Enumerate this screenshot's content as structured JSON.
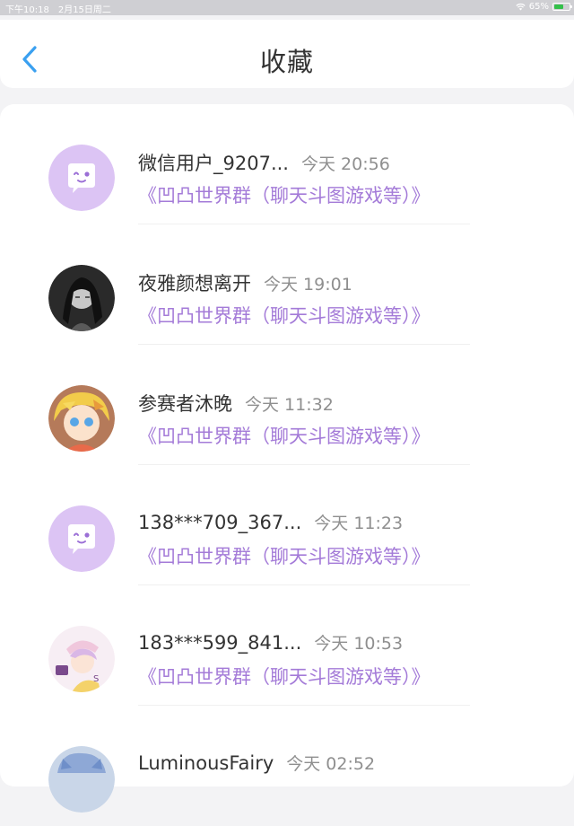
{
  "status": {
    "time": "下午10:18",
    "date": "2月15日周二",
    "battery": "65%",
    "battery_level": 0.65,
    "icons": [
      "wifi-icon",
      "battery-icon"
    ]
  },
  "header": {
    "title": "收藏",
    "back_icon": "chevron-left-icon"
  },
  "colors": {
    "accent": "#3aa0f0",
    "group_text": "#a47bd8",
    "default_avatar_bg": "#dcc4f4"
  },
  "favorites": [
    {
      "name": "微信用户_9207...",
      "time": "今天 20:56",
      "group": "《凹凸世界群（聊天斗图游戏等）》",
      "avatar": "default-avatar-icon"
    },
    {
      "name": "夜雅颜想离开",
      "time": "今天 19:01",
      "group": "《凹凸世界群（聊天斗图游戏等）》",
      "avatar": "user-avatar-dark"
    },
    {
      "name": "参赛者沐晚",
      "time": "今天 11:32",
      "group": "《凹凸世界群（聊天斗图游戏等）》",
      "avatar": "user-avatar-yellow"
    },
    {
      "name": "138***709_367...",
      "time": "今天 11:23",
      "group": "《凹凸世界群（聊天斗图游戏等）》",
      "avatar": "default-avatar-icon"
    },
    {
      "name": "183***599_841...",
      "time": "今天 10:53",
      "group": "《凹凸世界群（聊天斗图游戏等）》",
      "avatar": "user-avatar-pink"
    },
    {
      "name": "LuminousFairy",
      "time": "今天 02:52",
      "group": "",
      "avatar": "user-avatar-blue"
    }
  ]
}
